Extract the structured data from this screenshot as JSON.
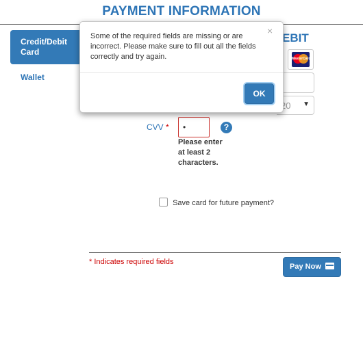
{
  "header": {
    "title": "PAYMENT INFORMATION"
  },
  "tabs": {
    "credit_label": "Credit/Debit Card",
    "wallet_label": "Wallet"
  },
  "form": {
    "card_type_tail": "EBIT",
    "card_logo": "mastercard-icon",
    "expiry_partial_value": "20",
    "cvv_label": "CVV",
    "required_marker": "*",
    "cvv_value": "•",
    "cvv_error": "Please enter at least 2 characters.",
    "save_card_label": "Save card for future payment?",
    "save_card_checked": false
  },
  "footer": {
    "required_note": "* Indicates required fields",
    "pay_button_label": "Pay Now"
  },
  "modal": {
    "message": "Some of the required fields are missing or are incorrect. Please make sure to fill out all the fields correctly and try again.",
    "close_glyph": "×",
    "ok_label": "OK"
  },
  "colors": {
    "brand": "#2e75b6",
    "button": "#337ab7",
    "error": "#c9302c"
  }
}
